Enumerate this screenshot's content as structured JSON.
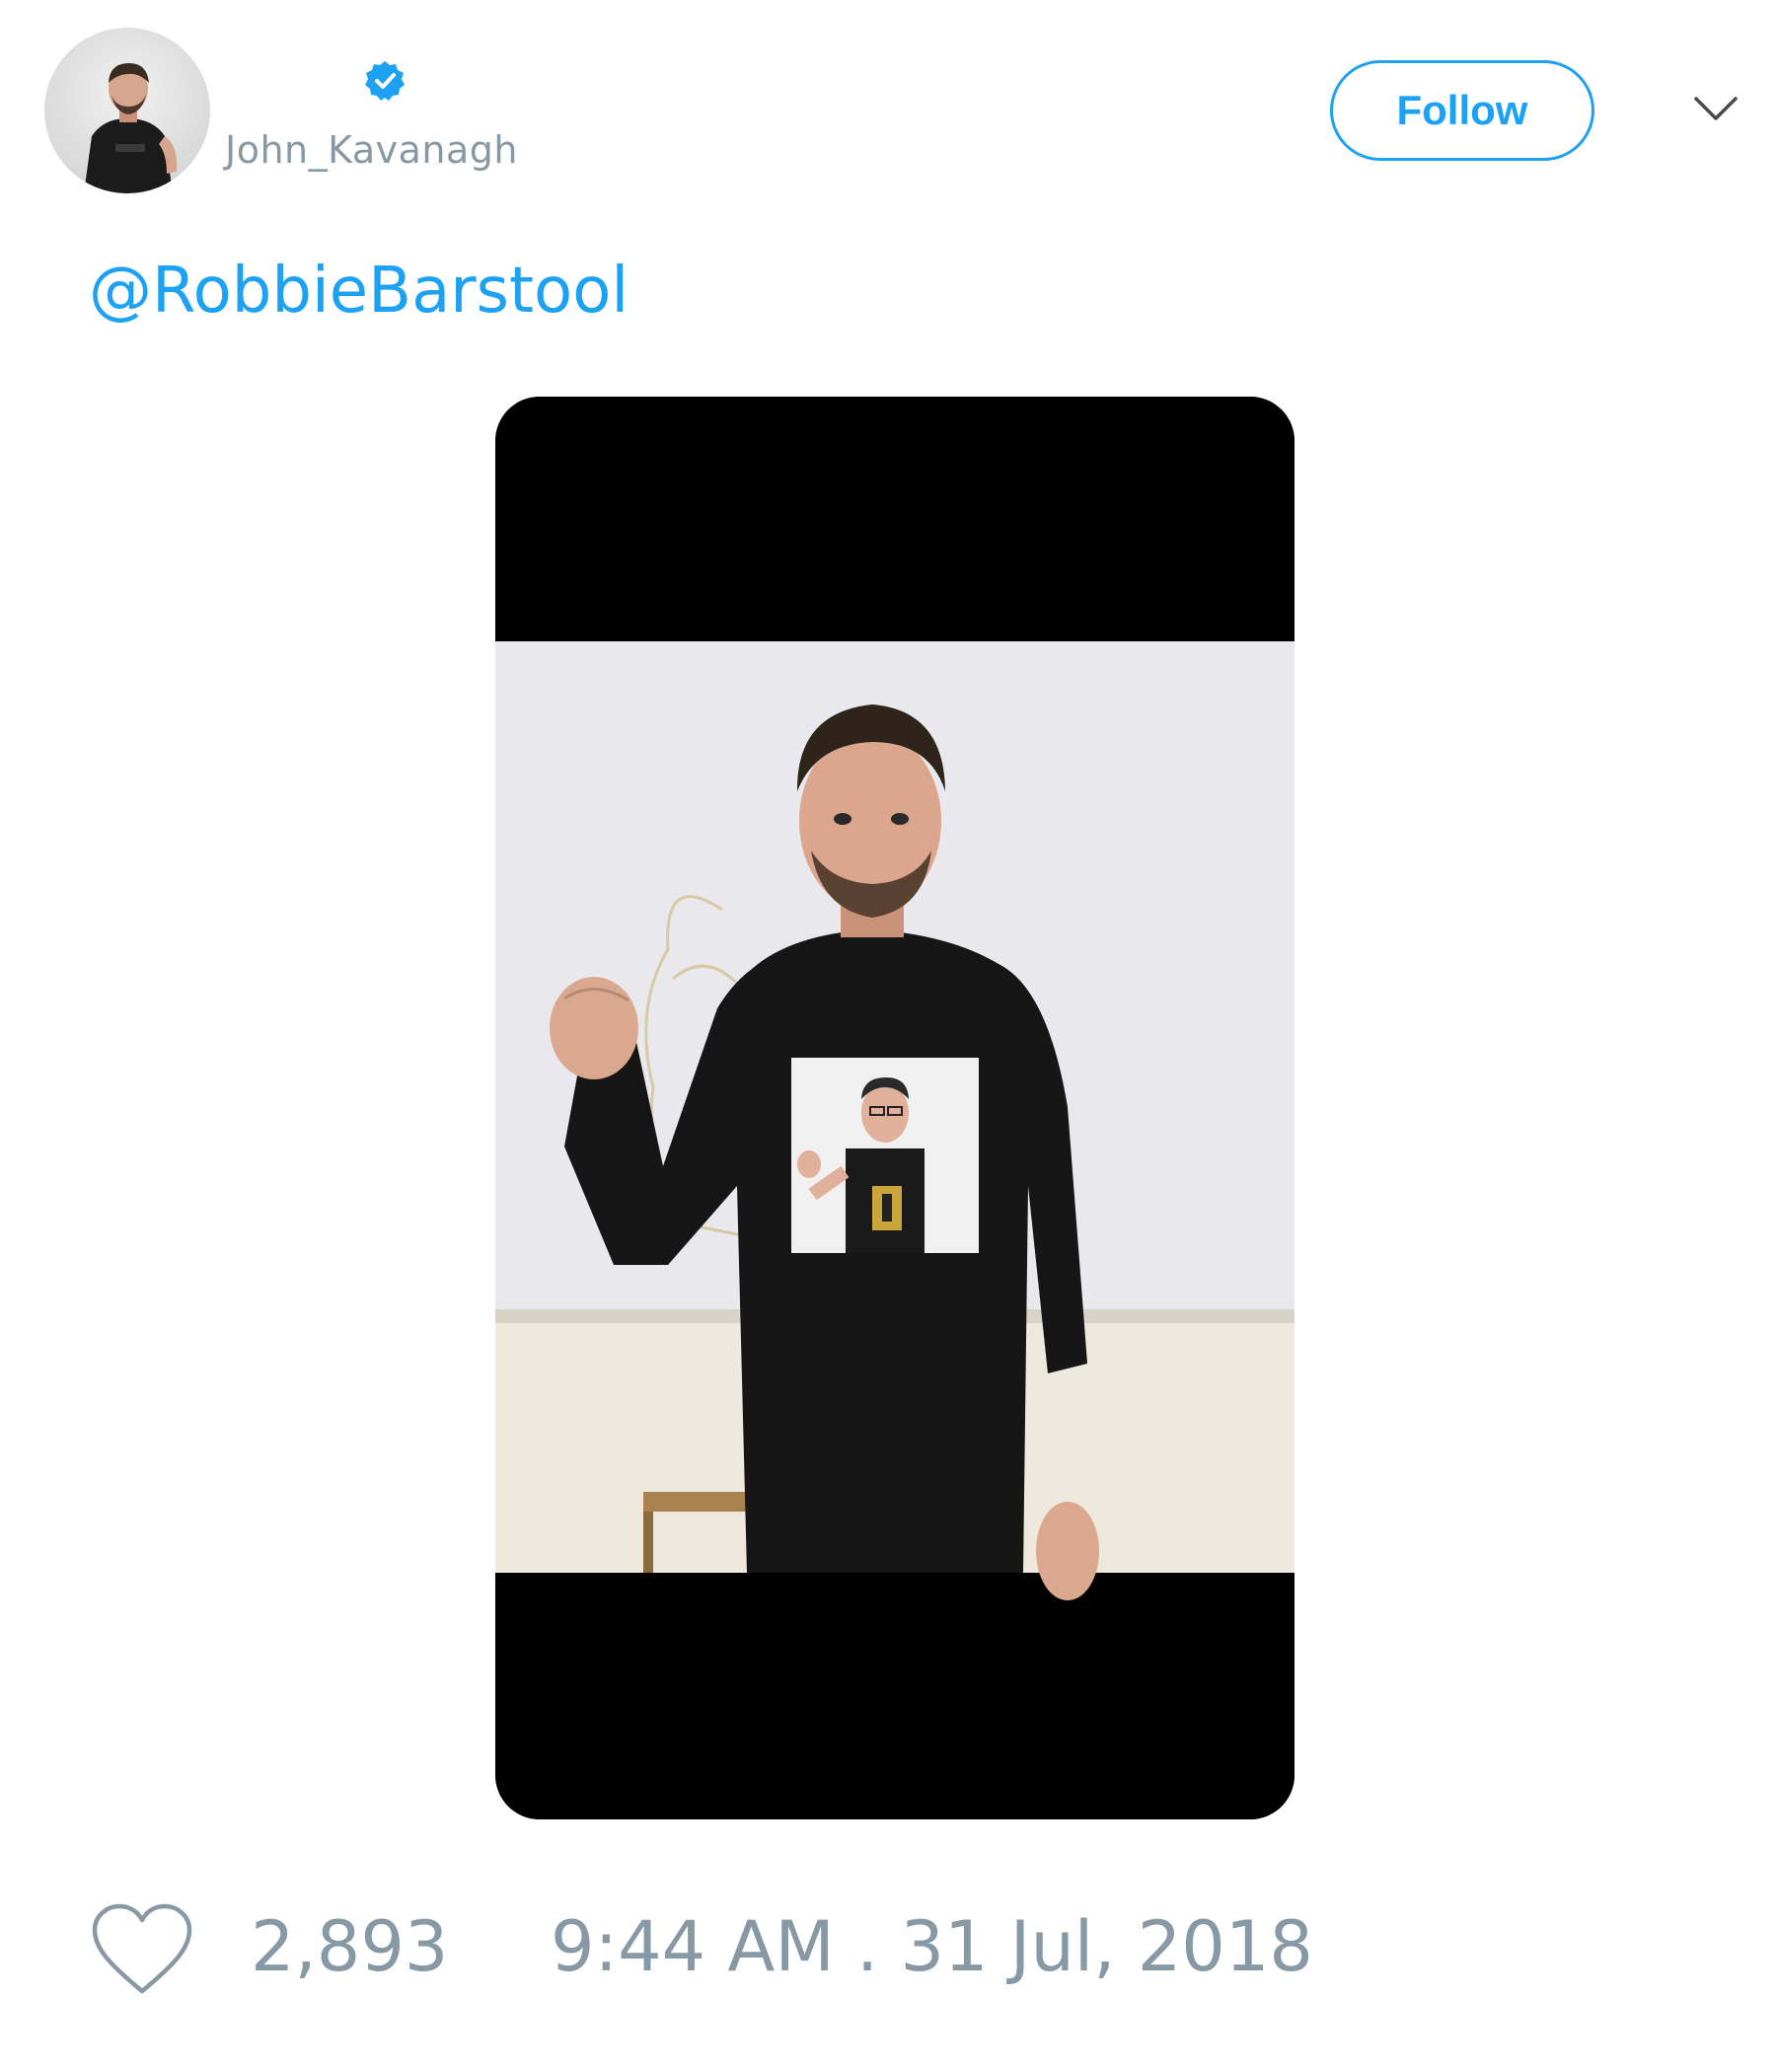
{
  "tweet": {
    "author": {
      "handle": "John_Kavanagh",
      "verified": true,
      "avatar_icon": "profile-photo"
    },
    "follow_label": "Follow",
    "menu_icon": "chevron-down-icon",
    "text": "@RobbieBarstool",
    "media": {
      "icon": "photo-man-raising-fist",
      "background": "#000000"
    },
    "likes": "2,893",
    "timestamp": "9:44 AM . 31 Jul, 2018"
  },
  "colors": {
    "accent": "#1da1f2",
    "muted": "#8899a6",
    "background": "#ffffff"
  }
}
